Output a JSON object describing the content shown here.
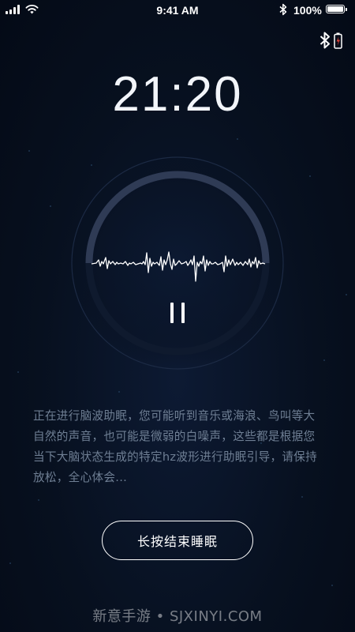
{
  "status_bar": {
    "time": "9:41 AM",
    "battery_percent": "100%",
    "icons": [
      "signal-icon",
      "wifi-icon",
      "bluetooth-icon",
      "battery-icon"
    ]
  },
  "device_status": {
    "icons": [
      "bluetooth-icon",
      "low-battery-icon"
    ],
    "battery_color": "#e0443a"
  },
  "sleep_timer": {
    "time": "21:20",
    "progress": 0.5
  },
  "player": {
    "control_icon": "pause-icon"
  },
  "description": "正在进行脑波助眠，您可能听到音乐或海浪、鸟叫等大自然的声音，也可能是微弱的白噪声，这些都是根据您当下大脑状态生成的特定hz波形进行助眠引导，请保持放松，全心体会...",
  "end_button": {
    "label": "长按结束睡眠"
  },
  "watermark": "新意手游 • SJXINYI.COM",
  "colors": {
    "background": "#07101f",
    "description_text": "#6f7f94",
    "ring_track": "#2f3b55"
  }
}
